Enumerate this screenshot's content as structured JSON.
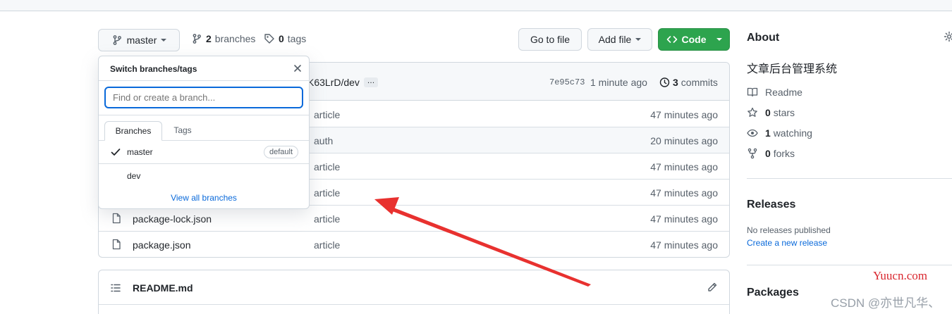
{
  "toolbar": {
    "branch_label": "master",
    "branches_count": "2",
    "branches_label": "branches",
    "tags_count": "0",
    "tags_label": "tags",
    "go_to_file": "Go to file",
    "add_file": "Add file",
    "code": "Code"
  },
  "commit": {
    "branch_text": "K63LrD/dev",
    "ellipsis": "…",
    "sha": "7e95c73",
    "time": "1 minute ago",
    "commits_count": "3",
    "commits_label": "commits"
  },
  "files": [
    {
      "name": "",
      "message": "article",
      "age": "47 minutes ago"
    },
    {
      "name": "",
      "message": "auth",
      "age": "20 minutes ago"
    },
    {
      "name": "",
      "message": "article",
      "age": "47 minutes ago"
    },
    {
      "name": "",
      "message": "article",
      "age": "47 minutes ago"
    },
    {
      "name": "package-lock.json",
      "message": "article",
      "age": "47 minutes ago"
    },
    {
      "name": "package.json",
      "message": "article",
      "age": "47 minutes ago"
    }
  ],
  "dropdown": {
    "title": "Switch branches/tags",
    "placeholder": "Find or create a branch...",
    "tab_branches": "Branches",
    "tab_tags": "Tags",
    "branches": [
      {
        "name": "master",
        "badge": "default",
        "selected": true
      },
      {
        "name": "dev",
        "badge": "",
        "selected": false
      }
    ],
    "view_all": "View all branches"
  },
  "readme": {
    "title": "README.md"
  },
  "about": {
    "heading": "About",
    "description": "文章后台管理系统",
    "readme": "Readme",
    "stars_count": "0",
    "stars_label": "stars",
    "watching_count": "1",
    "watching_label": "watching",
    "forks_count": "0",
    "forks_label": "forks"
  },
  "releases": {
    "heading": "Releases",
    "none": "No releases published",
    "create": "Create a new release"
  },
  "packages": {
    "heading": "Packages"
  },
  "watermark": {
    "site": "Yuucn.com",
    "csdn": "CSDN @亦世凡华、"
  },
  "colors": {
    "accent": "#0969da",
    "code_button": "#2da44e",
    "annotation_arrow": "#e8312f",
    "watermark_red": "#d9262e"
  }
}
